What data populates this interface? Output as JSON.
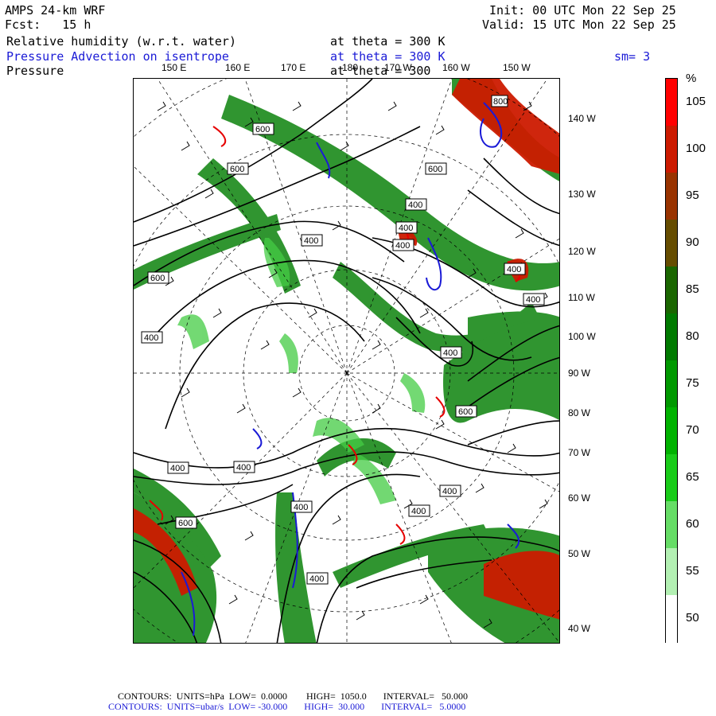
{
  "header": {
    "model": "AMPS 24-km WRF",
    "fcst": "Fcst:   15 h",
    "init": "Init: 00 UTC Mon 22 Sep 25",
    "valid": "Valid: 15 UTC Mon 22 Sep 25",
    "fields": [
      {
        "name": "Relative humidity (w.r.t. water)",
        "level": "at theta = 300 K",
        "color": "#000000"
      },
      {
        "name": "Pressure Advection on isentrope",
        "level": "at theta = 300 K",
        "color": "#1a1ad6"
      },
      {
        "name": "Pressure",
        "level": "at theta = 300",
        "color": "#000000"
      }
    ],
    "smoothing": "sm= 3"
  },
  "map": {
    "lon_top_labels": [
      "150 E",
      "160 E",
      "170 E",
      "180",
      "170 W",
      "160 W",
      "150 W"
    ],
    "lat_right_labels": [
      "140 W",
      "130 W",
      "120 W",
      "110 W",
      "100 W",
      "90 W",
      "80 W",
      "70 W",
      "60 W",
      "50 W",
      "40 W"
    ],
    "contour_labels": [
      "600",
      "600",
      "600",
      "400",
      "600",
      "400",
      "400",
      "400",
      "400",
      "400",
      "400",
      "400",
      "400",
      "400",
      "600",
      "400",
      "400",
      "400",
      "400",
      "800",
      "600",
      "600"
    ]
  },
  "colorbar": {
    "unit": "%",
    "labels": [
      "105",
      "100",
      "95",
      "90",
      "85",
      "80",
      "75",
      "70",
      "65",
      "60",
      "55",
      "50"
    ],
    "colors": [
      "#ff0000",
      "#cc1a00",
      "#993300",
      "#664d00",
      "#1a6600",
      "#007a00",
      "#009900",
      "#00b300",
      "#19cc19",
      "#66dd66",
      "#b3f0b3",
      "#ffffff"
    ]
  },
  "footer": {
    "line1": "CONTOURS:  UNITS=hPa  LOW=  0.0000        HIGH=  1050.0       INTERVAL=   50.000",
    "line2": "CONTOURS:  UNITS=ubar/s  LOW= -30.000       HIGH=  30.000       INTERVAL=   5.0000"
  }
}
